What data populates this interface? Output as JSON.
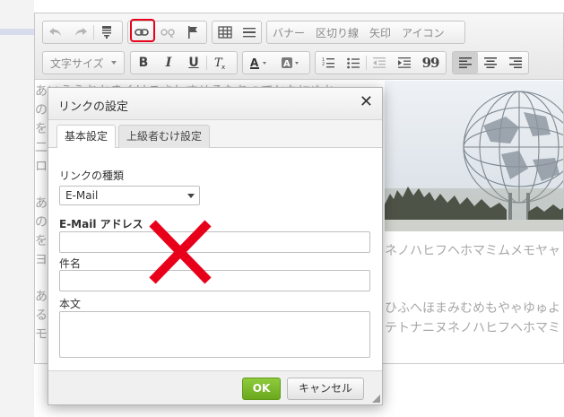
{
  "toolbar": {
    "row2_text_buttons": [
      "バナー",
      "区切り線",
      "矢印",
      "アイコン"
    ],
    "font_size_label": "文字サイズ",
    "bold_label": "B",
    "italic_label": "I",
    "underline_label": "U",
    "quote_label": "99",
    "icons": [
      "undo-icon",
      "redo-icon",
      "paste-format-icon",
      "link-icon",
      "unlink-icon",
      "anchor-flag-icon",
      "table-icon",
      "horizontal-rule-icon",
      "clear-format-icon",
      "text-color-icon",
      "background-color-icon",
      "numbered-list-icon",
      "bulleted-list-icon",
      "outdent-icon",
      "indent-icon",
      "blockquote-icon",
      "align-left-icon",
      "align-center-icon",
      "align-right-icon"
    ],
    "highlight_color": "#e8001a"
  },
  "content": {
    "lines": [
      "あいうえおかきくけこさしすせそたちつてとなにぬね",
      "の",
      "を",
      "二",
      "ロ",
      "あ",
      "の",
      "を",
      "ヨ",
      "あ",
      "る",
      "モ"
    ],
    "right_lines": [
      "ネノハヒフヘホマミムメモヤャ",
      "ひふへほまみむめもやゃゆゅよ",
      "テトナニヌネノハヒフヘホマミ"
    ]
  },
  "dialog": {
    "title": "リンクの設定",
    "close_glyph": "✕",
    "tabs": [
      "基本設定",
      "上級者むけ設定"
    ],
    "link_type_label": "リンクの種類",
    "link_type_value": "E-Mail",
    "email_label": "E-Mail アドレス",
    "subject_label": "件名",
    "body_label": "本文",
    "ok_label": "OK",
    "cancel_label": "キャンセル",
    "ok_color": "#7bb92a",
    "cross_color": "#e8001a"
  }
}
